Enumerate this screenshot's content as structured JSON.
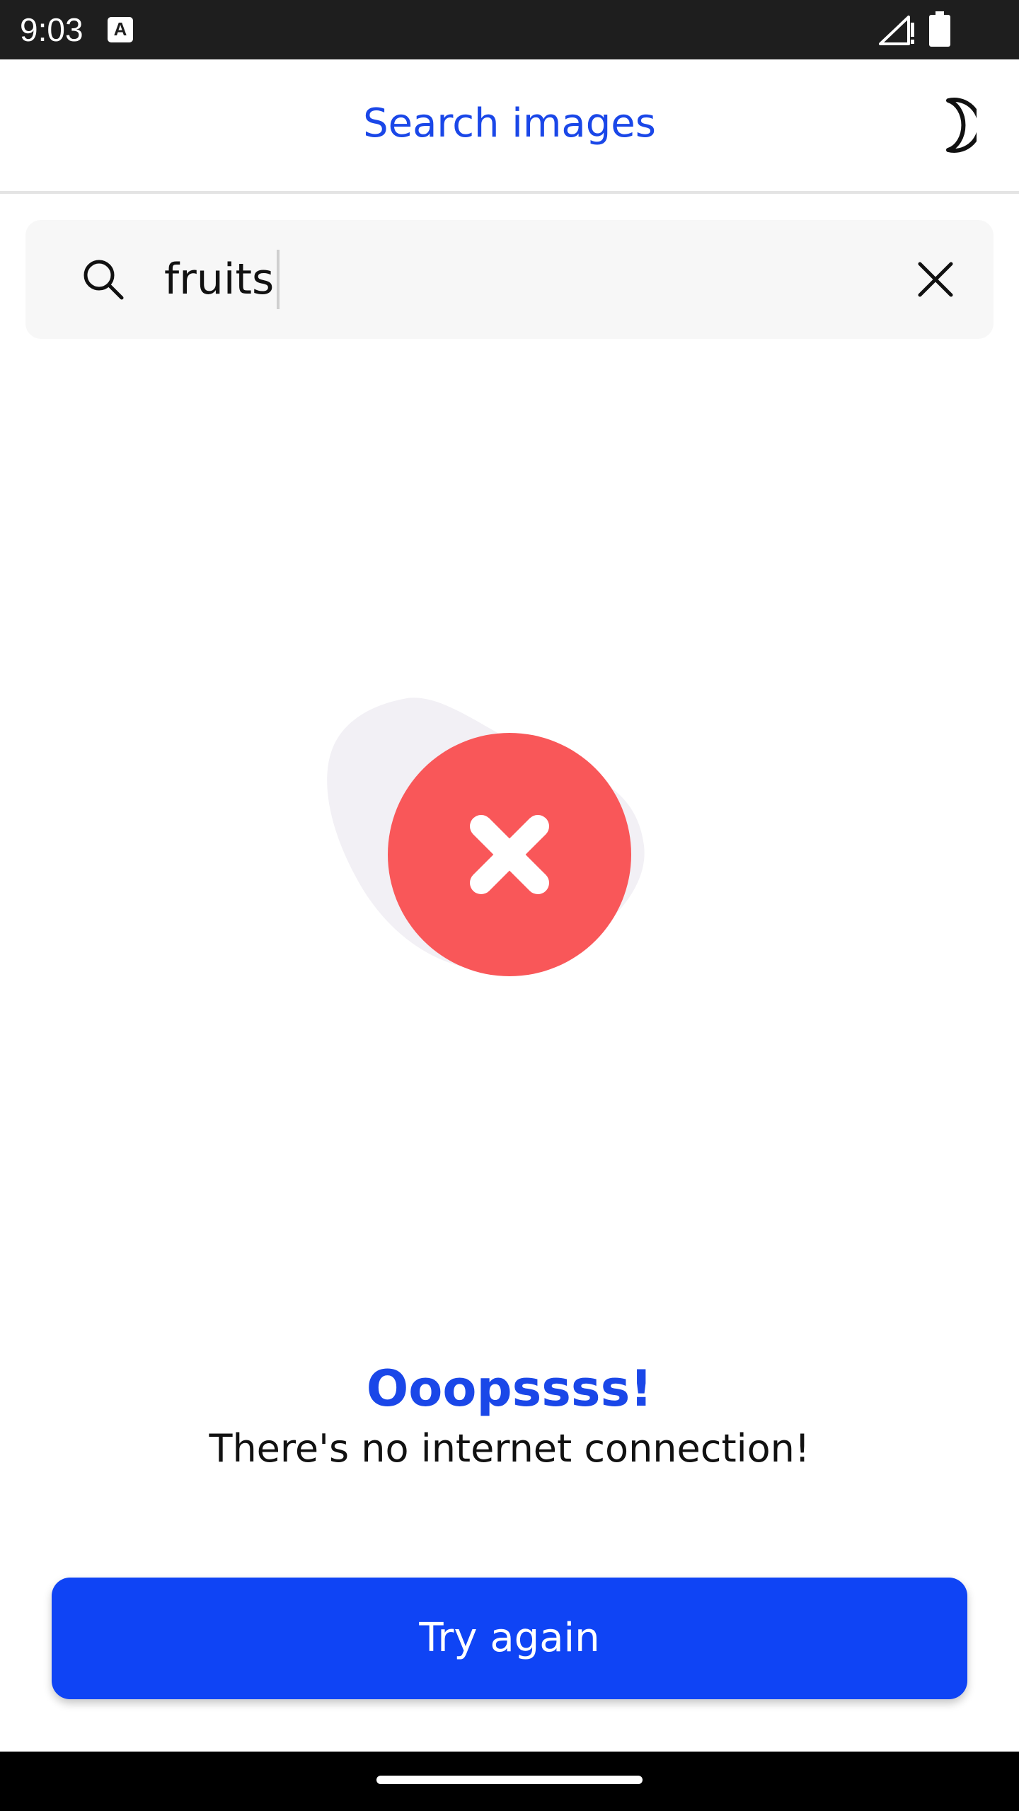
{
  "status_bar": {
    "time": "9:03",
    "notification_icon_letter": "A",
    "icons": [
      "signal-icon",
      "battery-icon"
    ]
  },
  "app_bar": {
    "title": "Search images",
    "theme_toggle_icon": "moon-icon"
  },
  "search": {
    "value": "fruits",
    "search_icon": "search-icon",
    "clear_icon": "close-icon"
  },
  "error_state": {
    "illustration_icon": "error-x-icon",
    "title": "Ooopssss!",
    "message": "There's no internet connection!",
    "retry_label": "Try again"
  },
  "colors": {
    "accent": "#1a47e8",
    "button": "#0f44f5",
    "error_red": "#f95759",
    "blob": "#f2f0f5",
    "status_bar": "#1e1e1e"
  }
}
